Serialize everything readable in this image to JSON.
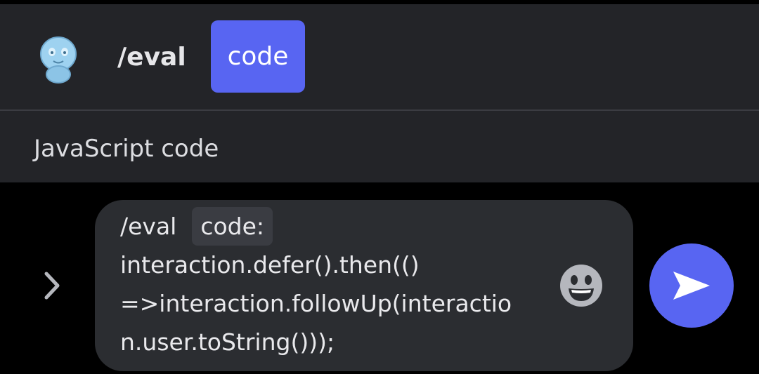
{
  "autocomplete": {
    "bot_avatar_icon": "bot-avatar-icon",
    "command": "/eval",
    "option_chip": "code",
    "option_description": "JavaScript code"
  },
  "composer": {
    "expand_icon": "chevron-right-icon",
    "command_prefix": "/eval",
    "option_label": "code:",
    "input_lines": [
      "interaction.defer().then(()",
      "=>interaction.followUp(interactio",
      "n.user.toString()));"
    ],
    "emoji_icon": "smiley-icon",
    "send_icon": "send-arrow-icon"
  },
  "colors": {
    "accent": "#5865f2",
    "panel_bg": "#232428",
    "input_bg": "#2b2d31"
  }
}
